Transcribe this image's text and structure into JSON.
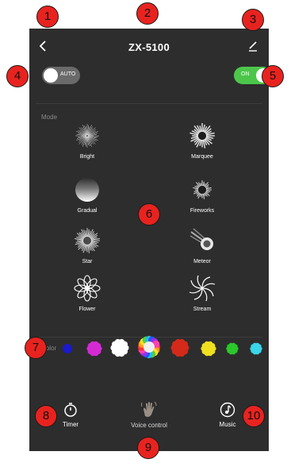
{
  "header": {
    "title": "ZX-5100"
  },
  "toggles": {
    "auto_label": "AUTO",
    "on_label": "ON",
    "on_color": "#4cc64a"
  },
  "mode": {
    "section_label": "Mode",
    "items": [
      {
        "label": "Bright",
        "icon": "bright-burst-icon"
      },
      {
        "label": "Marquee",
        "icon": "marquee-sun-icon"
      },
      {
        "label": "Gradual",
        "icon": "gradual-circle-icon"
      },
      {
        "label": "Fireworks",
        "icon": "fireworks-icon"
      },
      {
        "label": "Star",
        "icon": "star-burst-icon"
      },
      {
        "label": "Meteor",
        "icon": "meteor-icon"
      },
      {
        "label": "Flower",
        "icon": "flower-icon"
      },
      {
        "label": "Stream",
        "icon": "stream-swirl-icon"
      }
    ]
  },
  "color": {
    "section_label": "Color",
    "swatches": [
      "#1a1acc",
      "#d42ad4",
      "#ffffff",
      "rainbow",
      "#d42a1a",
      "#f0e020",
      "#2ac82a",
      "#3ad6e8"
    ]
  },
  "bottom_nav": {
    "timer_label": "Timer",
    "voice_label": "Voice control",
    "music_label": "Music"
  },
  "callouts": [
    "1",
    "2",
    "3",
    "4",
    "5",
    "6",
    "7",
    "8",
    "9",
    "10"
  ]
}
